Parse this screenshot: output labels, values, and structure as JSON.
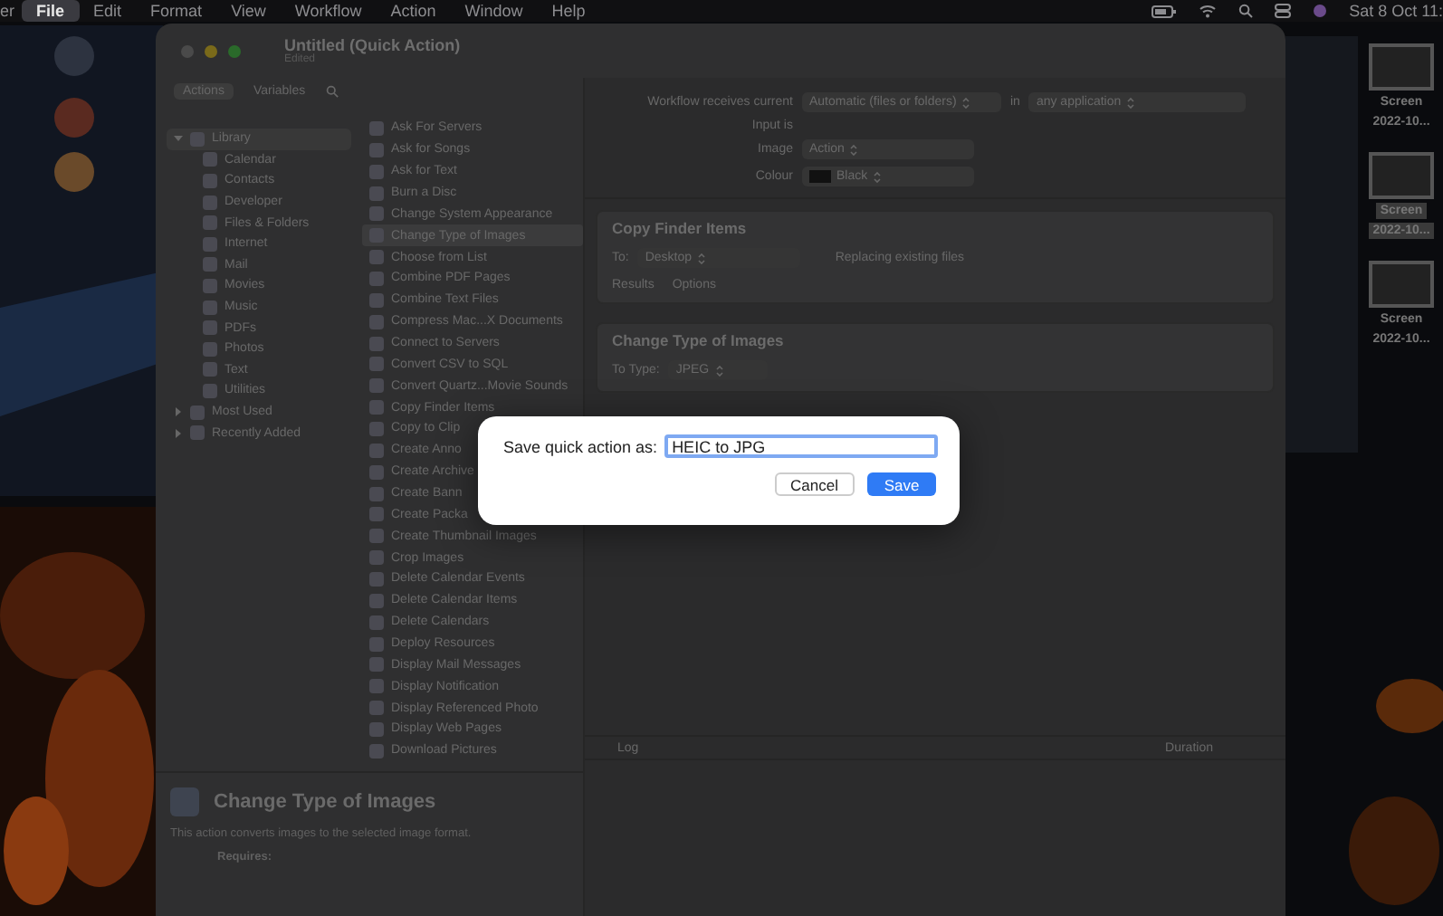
{
  "menu_bar": {
    "app_fragment": "er",
    "items": [
      {
        "label": "File",
        "selected": true
      },
      {
        "label": "Edit",
        "selected": false
      },
      {
        "label": "Format",
        "selected": false
      },
      {
        "label": "View",
        "selected": false
      },
      {
        "label": "Workflow",
        "selected": false
      },
      {
        "label": "Action",
        "selected": false
      },
      {
        "label": "Window",
        "selected": false
      },
      {
        "label": "Help",
        "selected": false
      }
    ],
    "clock": "Sat 8 Oct 11:"
  },
  "desktop": {
    "files": [
      {
        "name": "Screen",
        "date": "2022-10...",
        "selected": false
      },
      {
        "name": "Screen",
        "date": "2022-10...",
        "selected": true
      },
      {
        "name": "Screen",
        "date": "2022-10...",
        "selected": false
      }
    ]
  },
  "window": {
    "title": "Untitled (Quick Action)",
    "subtitle": "Edited",
    "library_tabs": [
      {
        "label": "Actions",
        "selected": true
      },
      {
        "label": "Variables",
        "selected": false
      }
    ],
    "library": [
      {
        "label": "Library",
        "expanded": true,
        "children": [
          {
            "label": "Calendar"
          },
          {
            "label": "Contacts"
          },
          {
            "label": "Developer"
          },
          {
            "label": "Files & Folders"
          },
          {
            "label": "Internet"
          },
          {
            "label": "Mail"
          },
          {
            "label": "Movies"
          },
          {
            "label": "Music"
          },
          {
            "label": "PDFs"
          },
          {
            "label": "Photos"
          },
          {
            "label": "Text"
          },
          {
            "label": "Utilities"
          }
        ]
      },
      {
        "label": "Most Used",
        "expanded": false
      },
      {
        "label": "Recently Added",
        "expanded": false
      }
    ],
    "actions": [
      {
        "label": "Ask For Servers",
        "selected": false
      },
      {
        "label": "Ask for Songs",
        "selected": false
      },
      {
        "label": "Ask for Text",
        "selected": false
      },
      {
        "label": "Burn a Disc",
        "selected": false
      },
      {
        "label": "Change System Appearance",
        "selected": false
      },
      {
        "label": "Change Type of Images",
        "selected": true
      },
      {
        "label": "Choose from List",
        "selected": false
      },
      {
        "label": "Combine PDF Pages",
        "selected": false
      },
      {
        "label": "Combine Text Files",
        "selected": false
      },
      {
        "label": "Compress Mac...X Documents",
        "selected": false
      },
      {
        "label": "Connect to Servers",
        "selected": false
      },
      {
        "label": "Convert CSV to SQL",
        "selected": false
      },
      {
        "label": "Convert Quartz...Movie Sounds",
        "selected": false
      },
      {
        "label": "Copy Finder Items",
        "selected": false
      },
      {
        "label": "Copy to Clip",
        "selected": false
      },
      {
        "label": "Create Anno",
        "selected": false
      },
      {
        "label": "Create Archive",
        "selected": false
      },
      {
        "label": "Create Bann",
        "selected": false
      },
      {
        "label": "Create Packa",
        "selected": false
      },
      {
        "label": "Create Thumbnail Images",
        "selected": false
      },
      {
        "label": "Crop Images",
        "selected": false
      },
      {
        "label": "Delete Calendar Events",
        "selected": false
      },
      {
        "label": "Delete Calendar Items",
        "selected": false
      },
      {
        "label": "Delete Calendars",
        "selected": false
      },
      {
        "label": "Deploy Resources",
        "selected": false
      },
      {
        "label": "Display Mail Messages",
        "selected": false
      },
      {
        "label": "Display Notification",
        "selected": false
      },
      {
        "label": "Display Referenced Photo",
        "selected": false
      },
      {
        "label": "Display Web Pages",
        "selected": false
      },
      {
        "label": "Download Pictures",
        "selected": false
      }
    ],
    "workflow": {
      "receives_label": "Workflow receives current",
      "receives_value": "Automatic (files or folders)",
      "in_label": "in",
      "in_value": "any application",
      "input_label": "Input is",
      "image_label": "Image",
      "image_value": "Action",
      "colour_label": "Colour",
      "colour_value": "Black"
    },
    "steps": [
      {
        "title": "Copy Finder Items",
        "kind": "copy",
        "to_label": "To:",
        "to_value": "Desktop",
        "option": "Replacing existing files",
        "tabs": [
          "Results",
          "Options"
        ]
      },
      {
        "title": "Change Type of Images",
        "kind": "convert",
        "to_label": "To Type:",
        "to_value": "JPEG"
      }
    ],
    "log": {
      "columns": [
        "Log",
        "Duration"
      ]
    },
    "description": {
      "title": "Change Type of Images",
      "text": "This action converts images to the selected image format.",
      "requires_label": "Requires:"
    }
  },
  "dialog": {
    "label": "Save quick action as:",
    "value": "HEIC to JPG",
    "buttons": [
      {
        "label": "Cancel",
        "kind": "cancel"
      },
      {
        "label": "Save",
        "kind": "default"
      }
    ]
  }
}
